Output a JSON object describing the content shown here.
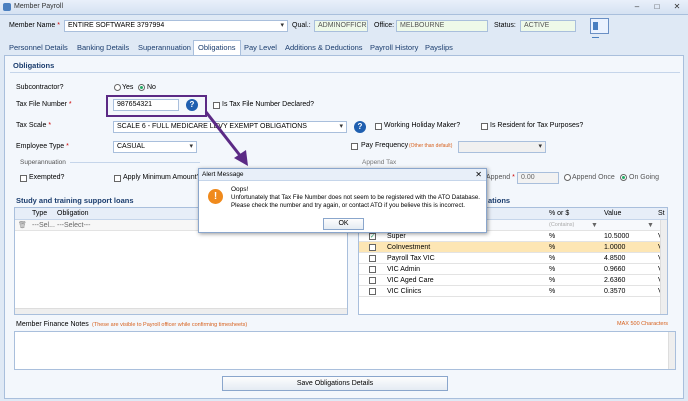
{
  "window": {
    "title": "Member Payroll"
  },
  "header": {
    "member_name_label": "Member Name",
    "member_name_value": "ENTIRE SOFTWARE 3797994",
    "qual_label": "Qual.:",
    "qual_value": "ADMINOFFICR",
    "office_label": "Office:",
    "office_value": "MELBOURNE",
    "status_label": "Status:",
    "status_value": "ACTIVE"
  },
  "tabs": [
    "Personnel Details",
    "Banking Details",
    "Superannuation",
    "Obligations",
    "Pay Level",
    "Additions & Deductions",
    "Payroll History",
    "Payslips"
  ],
  "obligations": {
    "section_title": "Obligations",
    "subcontractor_label": "Subcontractor?",
    "yes": "Yes",
    "no": "No",
    "tfn_label": "Tax File Number",
    "tfn_value": "987654321",
    "tfn_declared": "Is Tax File Number Declared?",
    "tax_scale_label": "Tax Scale",
    "tax_scale_value": "SCALE 6 - FULL MEDICARE LEVY EXEMPT OBLIGATIONS",
    "working_holiday": "Working Holiday Maker?",
    "resident": "Is Resident for Tax Purposes?",
    "employee_type_label": "Employee Type",
    "employee_type_value": "CASUAL",
    "pay_frequency": "Pay Frequency",
    "pay_frequency_hint": "(Other than default)",
    "append_tax": "Append Tax",
    "append_label": "Append",
    "append_value": "0.00",
    "append_once": "Append Once",
    "on_going": "On Going",
    "superannuation": "Superannuation",
    "exempted": "Exempted?",
    "apply_min": "Apply Minimum Amount?"
  },
  "loans": {
    "title": "Study and training support loans",
    "col_type": "Type",
    "col_obligation": "Obligation",
    "row_type": "---Sel...",
    "row_obligation": "---Select---"
  },
  "oblig_grid": {
    "title": "ations",
    "col_pct": "% or $",
    "col_value": "Value",
    "col_st": "St",
    "filter_hint": "(Contains)",
    "rows": [
      {
        "name": "Super",
        "pct": "%",
        "value": "10.5000",
        "st": "VI"
      },
      {
        "name": "CoInvestment",
        "pct": "%",
        "value": "1.0000",
        "st": "VI"
      },
      {
        "name": "Payroll Tax VIC",
        "pct": "%",
        "value": "4.8500",
        "st": "VI"
      },
      {
        "name": "VIC Admin",
        "pct": "%",
        "value": "0.9660",
        "st": "VI"
      },
      {
        "name": "VIC Aged Care",
        "pct": "%",
        "value": "2.6360",
        "st": "VI"
      },
      {
        "name": "VIC Clinics",
        "pct": "%",
        "value": "0.3570",
        "st": "VI"
      }
    ]
  },
  "notes": {
    "label": "Member Finance Notes",
    "hint": "(These are visible to Payroll officer while confirming timesheets)",
    "max": "MAX 500 Characters"
  },
  "save_button": "Save Obligations Details",
  "alert": {
    "title": "Alert Message",
    "heading": "Oops!",
    "line1": "Unfortunately that Tax File Number does not seem to be registered with the ATO Database.",
    "line2": "Please check the number and try again, or contact ATO if you believe this is incorrect.",
    "ok": "OK"
  },
  "colors": {
    "accent": "#1b3d6e",
    "highlight": "#5b2a85",
    "selected_row": "#fde6b4"
  }
}
